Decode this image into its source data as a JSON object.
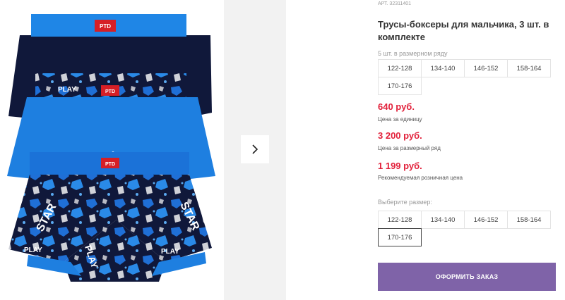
{
  "product": {
    "article_label": "АРТ.",
    "article_number": "32311401",
    "title": "Трусы-боксеры для мальчика, 3 шт. в комплекте"
  },
  "gallery": {
    "brand_tag": "PTD",
    "print_words": [
      "PLAY",
      "STAR"
    ],
    "next_icon": "chevron-right-icon",
    "colors": {
      "navy": "#10183a",
      "blue": "#1e7fe0",
      "tag_red": "#d61f26"
    }
  },
  "size_row": {
    "label": "5 шт. в размерном ряду",
    "sizes": [
      "122-128",
      "134-140",
      "146-152",
      "158-164",
      "170-176"
    ]
  },
  "prices": {
    "unit_price": "640 руб.",
    "unit_note": "Цена за единицу",
    "row_price": "3 200 руб.",
    "row_note": "Цена за размерный ряд",
    "retail_price": "1 199 руб.",
    "retail_note": "Рекомендуемая розничная цена"
  },
  "size_select": {
    "label": "Выберите размер:",
    "sizes": [
      "122-128",
      "134-140",
      "146-152",
      "158-164",
      "170-176"
    ],
    "selected": "170-176"
  },
  "order_button": {
    "label": "ОФОРМИТЬ ЗАКАЗ"
  },
  "colors": {
    "accent": "#7f63a8",
    "price": "#e2213b"
  }
}
